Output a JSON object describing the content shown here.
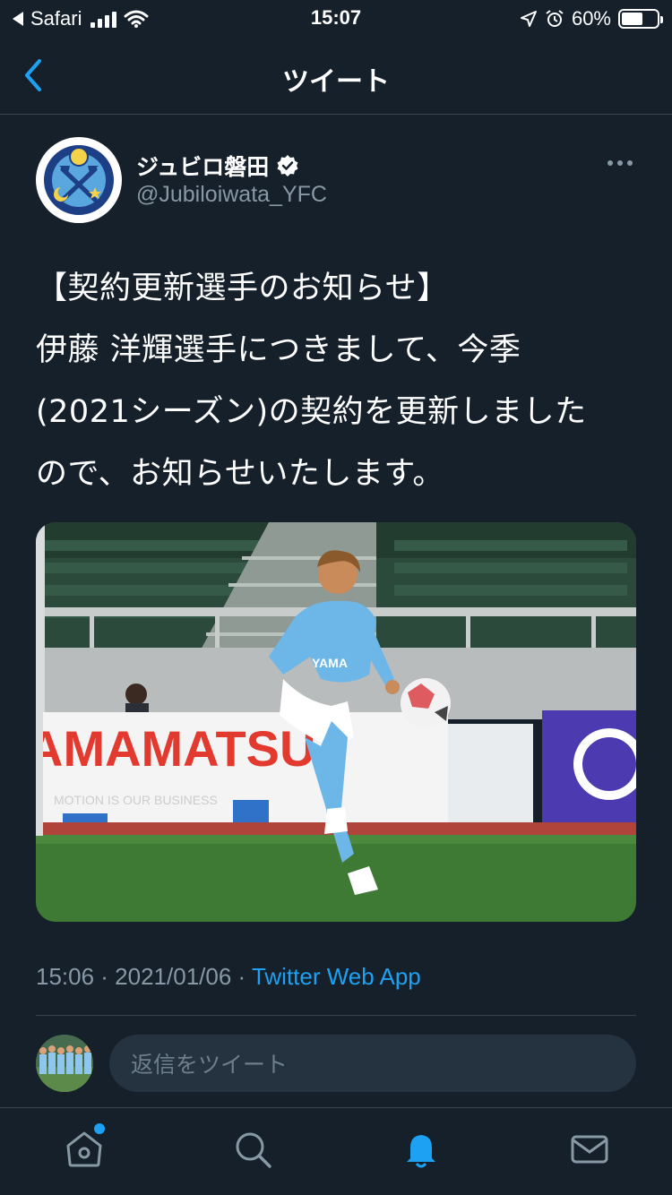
{
  "status_bar": {
    "carrier": "Safari",
    "time": "15:07",
    "battery": "60%",
    "battery_level": 0.6
  },
  "nav": {
    "title": "ツイート"
  },
  "tweet": {
    "author_name": "ジュビロ磐田",
    "author_handle": "@Jubiloiwata_YFC",
    "text": "【契約更新選手のお知らせ】\n伊藤 洋輝選手につきまして、今季\n(2021シーズン)の契約を更新しました\nので、お知らせいたします。",
    "timestamp": "15:06 · 2021/01/06 · ",
    "source": "Twitter Web App"
  },
  "reply": {
    "placeholder": "返信をツイート"
  },
  "tabbar": {
    "items": [
      "home-icon",
      "search-icon",
      "notifications-icon",
      "messages-icon"
    ],
    "active": "notifications-icon",
    "accent": "#1da1f2"
  },
  "colors": {
    "background": "#15202b",
    "accent": "#1da1f2",
    "secondary_text": "#8899a6"
  }
}
